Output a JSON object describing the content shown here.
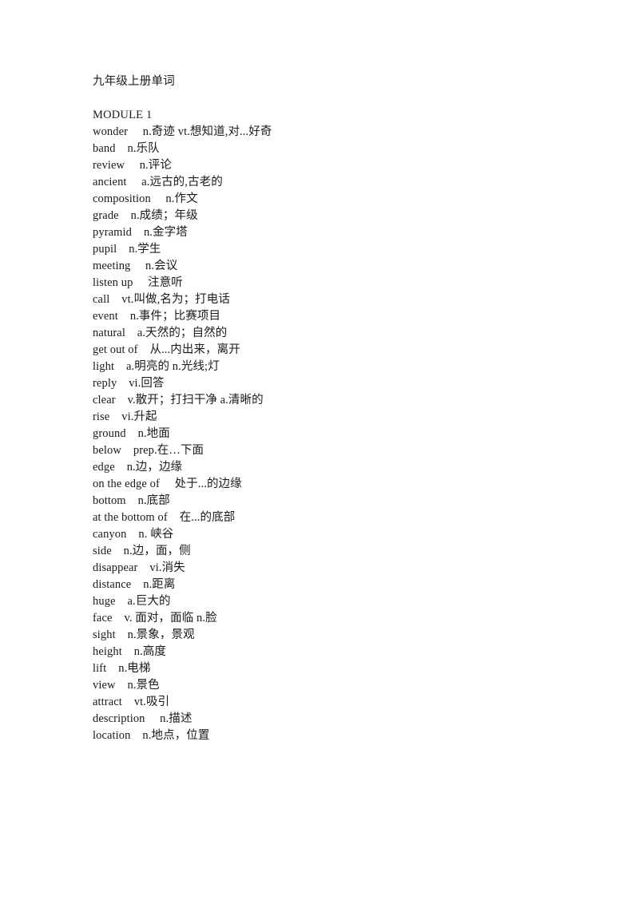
{
  "document": {
    "title": "九年级上册单词",
    "module_heading": "MODULE 1",
    "entries": [
      {
        "term": "wonder",
        "gap": "     ",
        "definition": "n.奇迹 vt.想知道,对...好奇"
      },
      {
        "term": "band",
        "gap": "    ",
        "definition": "n.乐队"
      },
      {
        "term": "review",
        "gap": "     ",
        "definition": "n.评论"
      },
      {
        "term": "ancient",
        "gap": "     ",
        "definition": "a.远古的,古老的"
      },
      {
        "term": "composition",
        "gap": "     ",
        "definition": "n.作文"
      },
      {
        "term": "grade",
        "gap": "    ",
        "definition": "n.成绩；年级"
      },
      {
        "term": "pyramid",
        "gap": "    ",
        "definition": "n.金字塔"
      },
      {
        "term": "pupil",
        "gap": "    ",
        "definition": "n.学生"
      },
      {
        "term": "meeting",
        "gap": "     ",
        "definition": "n.会议"
      },
      {
        "term": "listen up",
        "gap": "     ",
        "definition": "注意听"
      },
      {
        "term": "call",
        "gap": "    ",
        "definition": "vt.叫做,名为；打电话"
      },
      {
        "term": "event",
        "gap": "    ",
        "definition": "n.事件；比赛项目"
      },
      {
        "term": "natural",
        "gap": "    ",
        "definition": "a.天然的；自然的"
      },
      {
        "term": "get out of",
        "gap": "    ",
        "definition": "从...内出来，离开"
      },
      {
        "term": "light",
        "gap": "    ",
        "definition": "a.明亮的 n.光线;灯"
      },
      {
        "term": "reply",
        "gap": "    ",
        "definition": "vi.回答"
      },
      {
        "term": "clear",
        "gap": "    ",
        "definition": "v.散开；打扫干净 a.清晰的"
      },
      {
        "term": "rise",
        "gap": "    ",
        "definition": "vi.升起"
      },
      {
        "term": "ground",
        "gap": "    ",
        "definition": "n.地面"
      },
      {
        "term": "below",
        "gap": "    ",
        "definition": "prep.在…下面"
      },
      {
        "term": "edge",
        "gap": "    ",
        "definition": "n.边，边缘"
      },
      {
        "term": "on the edge of",
        "gap": "     ",
        "definition": "处于...的边缘"
      },
      {
        "term": "bottom",
        "gap": "    ",
        "definition": "n.底部"
      },
      {
        "term": "at the bottom of",
        "gap": "    ",
        "definition": "在...的底部"
      },
      {
        "term": "canyon",
        "gap": "    ",
        "definition": "n. 峡谷"
      },
      {
        "term": "side",
        "gap": "    ",
        "definition": "n.边，面，侧"
      },
      {
        "term": "disappear",
        "gap": "    ",
        "definition": "vi.消失"
      },
      {
        "term": "distance",
        "gap": "    ",
        "definition": "n.距离"
      },
      {
        "term": "huge",
        "gap": "    ",
        "definition": "a.巨大的"
      },
      {
        "term": "face",
        "gap": "    ",
        "definition": "v. 面对，面临 n.脸"
      },
      {
        "term": "sight",
        "gap": "    ",
        "definition": "n.景象，景观"
      },
      {
        "term": "height",
        "gap": "    ",
        "definition": "n.高度"
      },
      {
        "term": "lift",
        "gap": "    ",
        "definition": "n.电梯"
      },
      {
        "term": "view",
        "gap": "    ",
        "definition": "n.景色"
      },
      {
        "term": "attract",
        "gap": "    ",
        "definition": "vt.吸引"
      },
      {
        "term": "description",
        "gap": "     ",
        "definition": "n.描述"
      },
      {
        "term": "location",
        "gap": "    ",
        "definition": "n.地点，位置"
      }
    ]
  }
}
